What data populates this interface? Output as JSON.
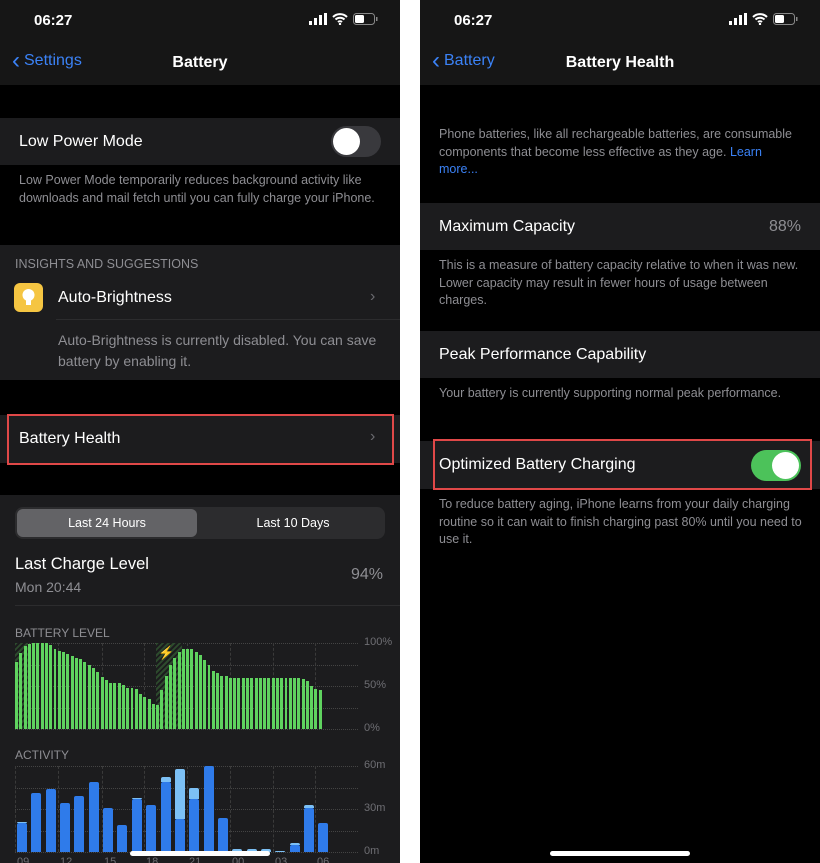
{
  "status": {
    "time": "06:27"
  },
  "left": {
    "nav": {
      "back": "Settings",
      "title": "Battery"
    },
    "low_power": {
      "label": "Low Power Mode",
      "on": false,
      "footer": "Low Power Mode temporarily reduces background activity like downloads and mail fetch until you can fully charge your iPhone."
    },
    "insights": {
      "header": "INSIGHTS AND SUGGESTIONS",
      "item": "Auto-Brightness",
      "desc": "Auto-Brightness is currently disabled. You can save battery by enabling it.",
      "icon": "lightbulb-icon",
      "icon_color": "#f5c542"
    },
    "battery_health": {
      "label": "Battery Health"
    },
    "segments": [
      "Last 24 Hours",
      "Last 10 Days"
    ],
    "selected_segment": "Last 24 Hours",
    "last_charge": {
      "label": "Last Charge Level",
      "time": "Mon 20:44",
      "value": "94%"
    },
    "home_indicator": true
  },
  "right": {
    "nav": {
      "back": "Battery",
      "title": "Battery Health"
    },
    "intro": "Phone batteries, like all rechargeable batteries, are consumable components that become less effective as they age.",
    "learn_more": "Learn more...",
    "max_capacity": {
      "label": "Maximum Capacity",
      "value": "88%",
      "footer": "This is a measure of battery capacity relative to when it was new. Lower capacity may result in fewer hours of usage between charges."
    },
    "peak": {
      "label": "Peak Performance Capability",
      "footer": "Your battery is currently supporting normal peak performance."
    },
    "optimized": {
      "label": "Optimized Battery Charging",
      "on": true,
      "footer": "To reduce battery aging, iPhone learns from your daily charging routine so it can wait to finish charging past 80% until you need to use it."
    }
  },
  "colors": {
    "accent": "#3b82f6",
    "battery_green": "#5fd35f",
    "activity_blue": "#2f7bea",
    "activity_light": "#7cc0f5",
    "toggle_on": "#4cc25a",
    "highlight_red": "#e04848"
  },
  "chart_data": [
    {
      "type": "bar",
      "title": "BATTERY LEVEL",
      "ylim": [
        0,
        100
      ],
      "yticks": [
        "100%",
        "50%",
        "0%"
      ],
      "values": [
        78,
        88,
        96,
        99,
        100,
        100,
        100,
        100,
        98,
        93,
        91,
        89,
        87,
        85,
        83,
        81,
        78,
        74,
        71,
        66,
        61,
        57,
        54,
        53,
        53,
        51,
        48,
        48,
        47,
        41,
        37,
        35,
        29,
        28,
        45,
        62,
        75,
        83,
        90,
        93,
        93,
        93,
        90,
        86,
        80,
        74,
        68,
        65,
        62,
        62,
        59,
        59,
        59,
        59,
        59,
        59,
        59,
        59,
        59,
        59,
        59,
        59,
        59,
        59,
        59,
        59,
        59,
        58,
        56,
        50,
        47,
        45
      ],
      "charging_ranges": [
        [
          0,
          2
        ],
        [
          33,
          38
        ]
      ]
    },
    {
      "type": "bar",
      "title": "ACTIVITY",
      "ylim": [
        0,
        60
      ],
      "yticks": [
        "60m",
        "30m",
        "0m"
      ],
      "xticks": [
        "09",
        "12",
        "15",
        "18",
        "21",
        "00",
        "03",
        "06"
      ],
      "series": [
        {
          "values": [
            20,
            41,
            44,
            34,
            39,
            49,
            31,
            19,
            37,
            33,
            49,
            23,
            37,
            60,
            24,
            0,
            0,
            0,
            0,
            5,
            31,
            20
          ]
        },
        {
          "values": [
            1,
            0,
            0,
            0,
            0,
            0,
            0,
            0,
            1,
            0,
            3,
            35,
            8,
            0,
            0,
            2,
            2,
            2,
            1,
            1,
            2,
            0
          ]
        }
      ]
    }
  ]
}
